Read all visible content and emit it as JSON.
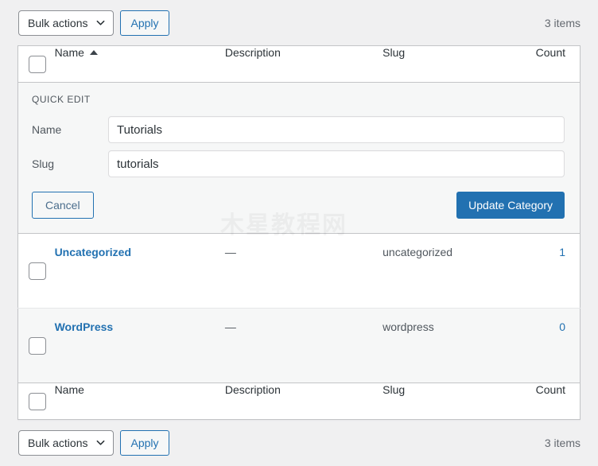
{
  "toolbar_top": {
    "bulk_actions_label": "Bulk actions",
    "apply_label": "Apply",
    "items_count": "3 items"
  },
  "toolbar_bottom": {
    "bulk_actions_label": "Bulk actions",
    "apply_label": "Apply",
    "items_count": "3 items"
  },
  "table": {
    "columns": {
      "name": "Name",
      "description": "Description",
      "slug": "Slug",
      "count": "Count"
    },
    "sort": {
      "column": "Name",
      "direction": "asc",
      "indicator": "triangle-up-icon"
    },
    "rows": [
      {
        "name": "Uncategorized",
        "description": "—",
        "slug": "uncategorized",
        "count": "1"
      },
      {
        "name": "WordPress",
        "description": "—",
        "slug": "wordpress",
        "count": "0"
      }
    ]
  },
  "quick_edit": {
    "legend": "QUICK EDIT",
    "name_label": "Name",
    "name_value": "Tutorials",
    "slug_label": "Slug",
    "slug_value": "tutorials",
    "cancel_label": "Cancel",
    "update_label": "Update Category"
  },
  "watermark": {
    "text": "木星教程网"
  },
  "colors": {
    "primary_blue": "#2271b1",
    "link_blue": "#2271b1",
    "page_background": "#f0f0f1",
    "row_alternate": "#f6f7f7",
    "border": "#c3c4c7",
    "text": "#3c434a"
  }
}
